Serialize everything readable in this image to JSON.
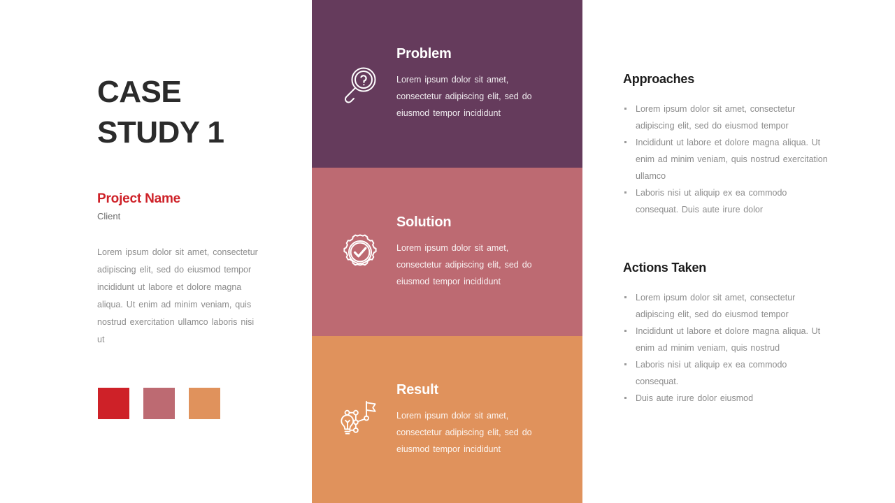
{
  "colors": {
    "title_dark": "#2b2b2b",
    "accent_red": "#CE2128",
    "panel_purple": "#653B5C",
    "panel_rose": "#BD6A72",
    "panel_orange": "#E0925C",
    "body_gray": "#8C8C8C",
    "background": "#FFFFFF"
  },
  "left": {
    "title_line_1": "CASE",
    "title_line_2": "STUDY 1",
    "project_name": "Project Name",
    "client_label": "Client",
    "body_text": "Lorem ipsum dolor sit amet, consectetur adipiscing elit, sed do eiusmod tempor incididunt ut labore et dolore magna aliqua. Ut enim ad minim veniam, quis nostrud exercitation ullamco laboris nisi ut",
    "swatches": [
      {
        "name": "swatch-red",
        "color": "#CE2128"
      },
      {
        "name": "swatch-rose",
        "color": "#BD6A72"
      },
      {
        "name": "swatch-orange",
        "color": "#E0925C"
      }
    ]
  },
  "panels": [
    {
      "id": "problem",
      "heading": "Problem",
      "body": "Lorem ipsum dolor sit amet, consectetur adipiscing elit, sed do eiusmod tempor incididunt",
      "bg": "#653B5C",
      "icon": "magnifier-question-icon"
    },
    {
      "id": "solution",
      "heading": "Solution",
      "body": "Lorem ipsum dolor sit amet, consectetur adipiscing elit, sed do eiusmod tempor incididunt",
      "bg": "#BD6A72",
      "icon": "gear-check-icon"
    },
    {
      "id": "result",
      "heading": "Result",
      "body": "Lorem ipsum dolor sit amet, consectetur adipiscing elit, sed do eiusmod tempor incididunt",
      "bg": "#E0925C",
      "icon": "lightbulb-path-flag-icon"
    }
  ],
  "right": {
    "approaches": {
      "heading": "Approaches",
      "bullets": [
        "Lorem ipsum dolor sit amet, consectetur adipiscing elit, sed do eiusmod tempor",
        "Incididunt ut labore et dolore magna aliqua. Ut enim ad minim veniam, quis nostrud exercitation ullamco",
        "Laboris nisi ut aliquip ex ea commodo consequat. Duis aute irure dolor"
      ]
    },
    "actions": {
      "heading": "Actions Taken",
      "bullets": [
        "Lorem ipsum dolor sit amet, consectetur adipiscing elit, sed do eiusmod tempor",
        "Incididunt ut labore et dolore magna aliqua. Ut enim ad minim veniam, quis nostrud",
        "Laboris nisi ut aliquip ex ea commodo consequat.",
        "Duis aute irure dolor eiusmod"
      ]
    }
  }
}
